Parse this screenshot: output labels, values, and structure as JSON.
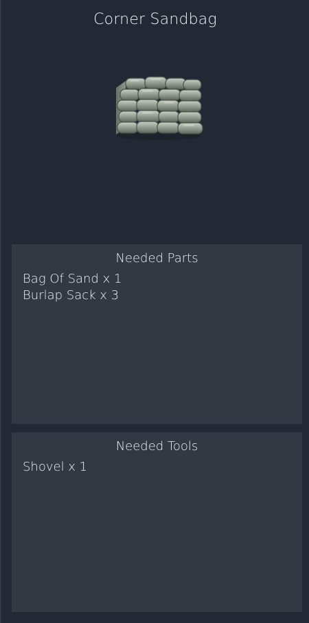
{
  "item": {
    "title": "Corner Sandbag",
    "image_icon": "sandbag-wall-icon"
  },
  "needed_parts": {
    "heading": "Needed Parts",
    "items": [
      "Bag Of Sand x 1",
      "Burlap Sack x 3"
    ]
  },
  "needed_tools": {
    "heading": "Needed Tools",
    "items": [
      "Shovel x 1"
    ]
  },
  "colors": {
    "background": "#232834",
    "section_background": "#333842",
    "text": "#eef0f3"
  }
}
